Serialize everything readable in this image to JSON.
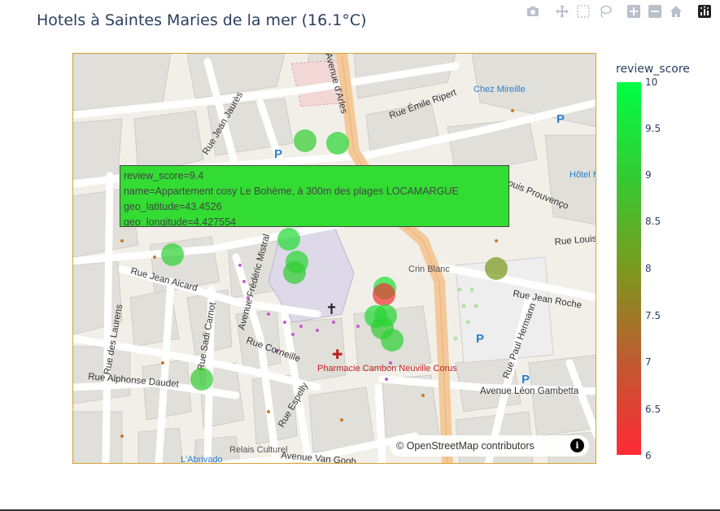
{
  "title": "Hotels à Saintes Maries de la mer (16.1°C)",
  "modebar": {
    "icons": [
      "camera-icon",
      "move-icon",
      "box-select-icon",
      "lasso-icon",
      "zoom-in-icon",
      "zoom-out-icon",
      "home-icon",
      "plotly-logo-icon"
    ]
  },
  "map": {
    "attribution_prefix": "©",
    "attribution_link": "OpenStreetMap",
    "attribution_suffix": "contributors",
    "info_symbol": "i",
    "street_labels": [
      "Rue Émile Ripert",
      "Rue Jean Aicard",
      "Rue Jean Roche",
      "Avenue Léon Gambetta",
      "Rue Alphonse Daudet",
      "Avenue Van Gogh",
      "Rue Corneille",
      "Rue Espelly",
      "Rue Sadi Carnot",
      "Rue des Laurens",
      "Rue Jean Jaurès",
      "Avenue Frédéric Mistral",
      "Rue Paul Hermann",
      "Avenue d'Arles",
      "Rue Louis Prouvenço",
      "Rue Louis",
      "Chez Mireille",
      "Hôtel Mirag",
      "Crin Blanc",
      "Pharmacie Cambon Neuville Corus",
      "Relais Culturel",
      "L'Abrivado",
      "Rue Jean Jaurès"
    ],
    "colors": {
      "accent": "#d4a437",
      "low": "#ff2a35",
      "high": "#00ff44"
    }
  },
  "tooltip": {
    "line1": "review_score=9.4",
    "line2": "name=Appartement cosy Le Bohème, à 300m des plages LOCAMARGUE",
    "line3": "geo_latitude=43.4526",
    "line4": "geo_longitude=4.427554"
  },
  "colorbar": {
    "title": "review_score",
    "ticks": [
      "10",
      "9.5",
      "9",
      "8.5",
      "8",
      "7.5",
      "7",
      "6.5",
      "6"
    ]
  },
  "chart_data": {
    "type": "scatter",
    "title": "Hotels à Saintes Maries de la mer (16.1°C)",
    "color_key": "review_score",
    "color_range": [
      6,
      10
    ],
    "points": [
      {
        "review_score": 9.4,
        "geo_latitude": 43.4526,
        "geo_longitude": 4.427554,
        "name": "Appartement cosy Le Bohème, à 300m des plages LOCAMARGUE"
      },
      {
        "review_score": 9.0
      },
      {
        "review_score": 9.2
      },
      {
        "review_score": 9.1
      },
      {
        "review_score": 9.3
      },
      {
        "review_score": 9.2
      },
      {
        "review_score": 9.0
      },
      {
        "review_score": 9.4
      },
      {
        "review_score": 6.3
      },
      {
        "review_score": 9.3
      },
      {
        "review_score": 9.0
      },
      {
        "review_score": 9.1
      },
      {
        "review_score": 9.0
      },
      {
        "review_score": 9.2
      },
      {
        "review_score": 8.0
      }
    ]
  }
}
